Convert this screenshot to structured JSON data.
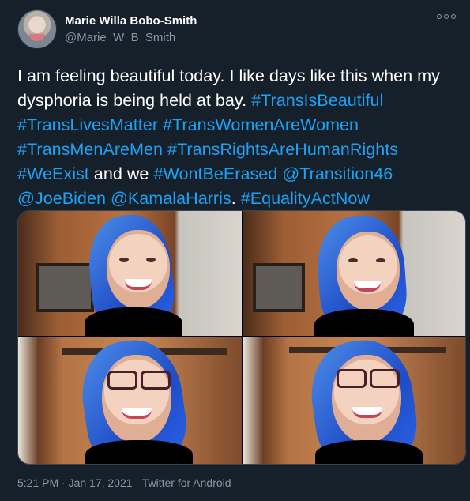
{
  "tweet": {
    "name": "Marie Willa Bobo-Smith",
    "handle": "@Marie_W_B_Smith",
    "text": [
      {
        "text": "I am feeling beautiful today. I like days like this when my dysphoria is being held at bay. ",
        "type": "plain"
      },
      {
        "text": "#TransIsBeautiful",
        "type": "tag"
      },
      {
        "text": " ",
        "type": "plain"
      },
      {
        "text": "#TransLivesMatter",
        "type": "tag"
      },
      {
        "text": " ",
        "type": "plain"
      },
      {
        "text": "#TransWomenAreWomen",
        "type": "tag"
      },
      {
        "text": " ",
        "type": "plain"
      },
      {
        "text": "#TransMenAreMen",
        "type": "tag"
      },
      {
        "text": " ",
        "type": "plain"
      },
      {
        "text": "#TransRightsAreHumanRights",
        "type": "tag"
      },
      {
        "text": " ",
        "type": "plain"
      },
      {
        "text": "#WeExist",
        "type": "tag"
      },
      {
        "text": " and we ",
        "type": "plain"
      },
      {
        "text": "#WontBeErased",
        "type": "tag"
      },
      {
        "text": " ",
        "type": "plain"
      },
      {
        "text": "@Transition46",
        "type": "tag"
      },
      {
        "text": " ",
        "type": "plain"
      },
      {
        "text": "@JoeBiden",
        "type": "tag"
      },
      {
        "text": " ",
        "type": "plain"
      },
      {
        "text": "@KamalaHarris",
        "type": "tag"
      },
      {
        "text": ". ",
        "type": "plain"
      },
      {
        "text": "#EqualityActNow",
        "type": "tag"
      }
    ],
    "timestamp": "5:21 PM · Jan 17, 2021 · Twitter for Android"
  },
  "colors": {
    "background": "#15202b",
    "link": "#1da1f2",
    "secondary_text": "#8899a6",
    "border": "#38444d"
  },
  "icons": {
    "more": "more-options-icon",
    "avatar": "profile-avatar"
  }
}
